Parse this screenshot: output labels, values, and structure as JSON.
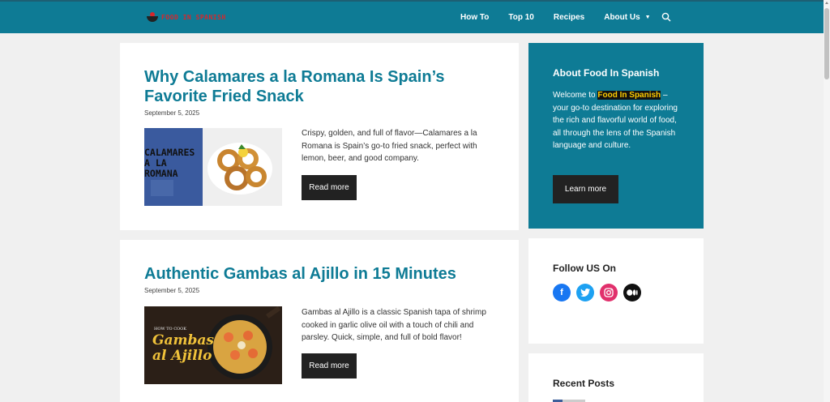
{
  "site": {
    "logo_text": "FOOD IN SPANISH"
  },
  "nav": {
    "items": [
      {
        "label": "How To"
      },
      {
        "label": "Top 10"
      },
      {
        "label": "Recipes"
      },
      {
        "label": "About Us"
      }
    ]
  },
  "posts": [
    {
      "title": "Why Calamares a la Romana Is Spain’s Favorite Fried Snack",
      "date": "September 5, 2025",
      "thumb_text": "CALAMARES A LA ROMANA",
      "excerpt": "Crispy, golden, and full of flavor—Calamares a la Romana is Spain’s go-to fried snack, perfect with lemon, beer, and good company.",
      "button": "Read more"
    },
    {
      "title": "Authentic Gambas al Ajillo in 15 Minutes",
      "date": "September 5, 2025",
      "thumb_small": "HOW TO COOK",
      "thumb_text": "Gambas al Ajillo",
      "excerpt": "Gambas al Ajillo is a classic Spanish tapa of shrimp cooked in garlic olive oil with a touch of chili and parsley. Quick, simple, and full of bold flavor!",
      "button": "Read more"
    }
  ],
  "sidebar": {
    "about": {
      "title": "About Food In Spanish",
      "intro": "Welcome to ",
      "highlight": "Food In Spanish",
      "body": " – your go-to destination for exploring the rich and flavorful world of food, all through the lens of the Spanish language and culture.",
      "button": "Learn more"
    },
    "follow": {
      "title": "Follow US On",
      "icons": [
        "facebook-icon",
        "twitter-icon",
        "instagram-icon",
        "medium-icon"
      ]
    },
    "recent": {
      "title": "Recent Posts"
    }
  },
  "colors": {
    "header": "#0e7b95",
    "title_link": "#0e7b95",
    "button": "#222222",
    "facebook": "#1877f2",
    "twitter": "#1da1f2",
    "instagram": "#e1306c",
    "medium": "#111111"
  }
}
